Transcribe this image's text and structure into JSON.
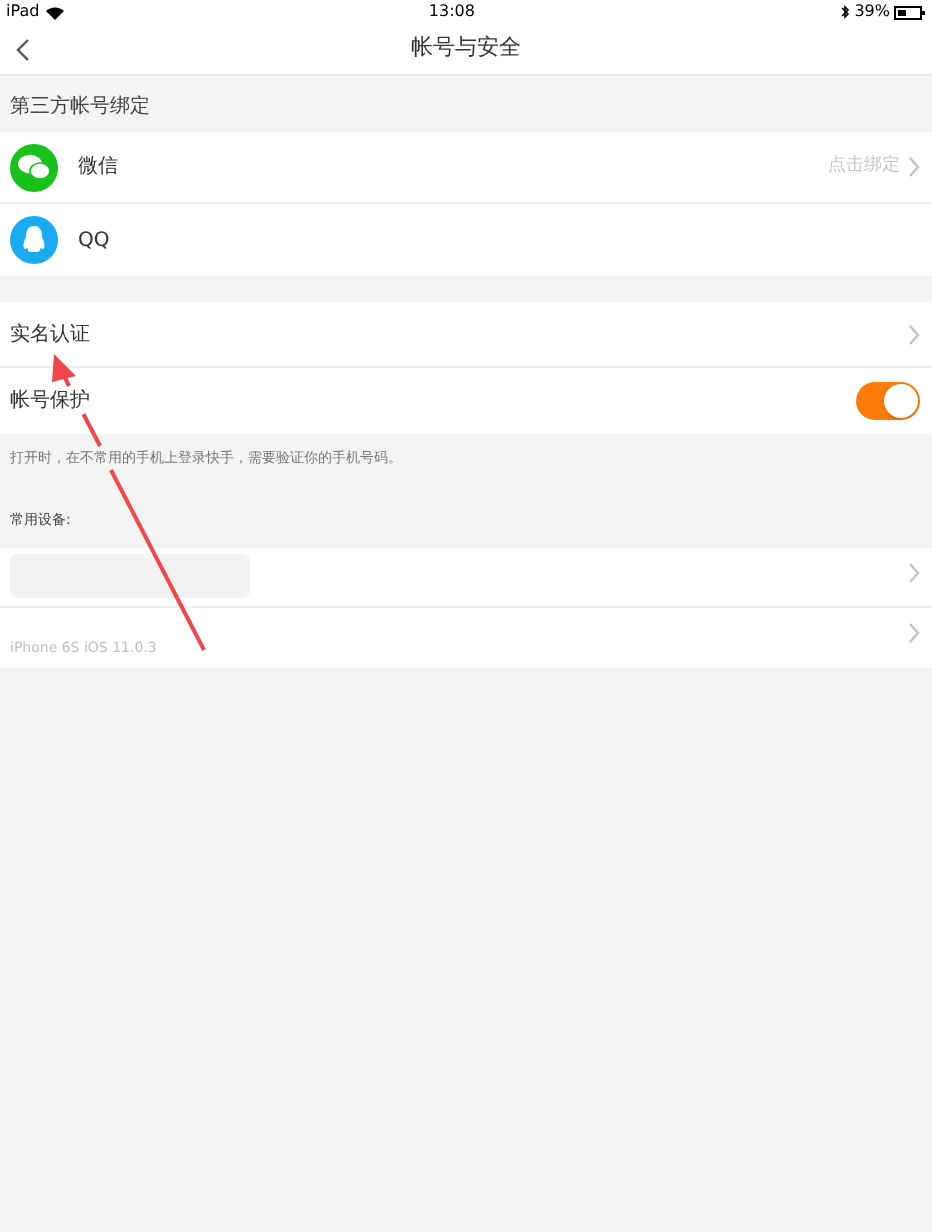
{
  "status_bar": {
    "device": "iPad",
    "time": "13:08",
    "battery": "39%"
  },
  "nav": {
    "title": "帐号与安全"
  },
  "third_party": {
    "header": "第三方帐号绑定",
    "rows": [
      {
        "kind": "wechat",
        "label": "微信",
        "action": "点击绑定"
      },
      {
        "kind": "qq",
        "label": "QQ"
      }
    ]
  },
  "security": [
    {
      "kind": "link",
      "label": "实名认证"
    },
    {
      "kind": "toggle",
      "label": "帐号保护",
      "on": true
    }
  ],
  "note": "打开时，在不常用的手机上登录快手，需要验证你的手机号码。",
  "devices": {
    "header": "常用设备:",
    "rows": [
      {
        "redacted": true
      },
      {
        "redacted": false,
        "name": "iPhone 6S iOS 11.0.3"
      }
    ]
  }
}
